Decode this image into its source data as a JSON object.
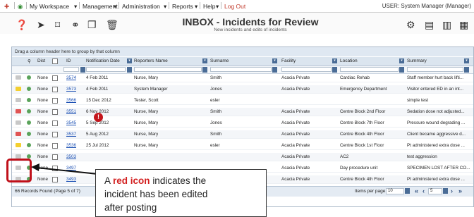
{
  "menubar": {
    "items": [
      "My Workspace",
      "Management",
      "Administration",
      "Reports",
      "Help"
    ],
    "logout": "Log Out",
    "user": "USER: System Manager (Manager)"
  },
  "page": {
    "title": "INBOX - Incidents for Review",
    "subtitle": "New incidents and edits of incidents"
  },
  "grid": {
    "group_hint": "Drag a column header here to group by that column",
    "columns": [
      "Dist",
      "ID",
      "Notification Date",
      "Reporters Name",
      "Surname",
      "Facility",
      "Location",
      "Summary"
    ],
    "rows": [
      {
        "dist": "None",
        "id": "3574",
        "date": "4 Feb 2011",
        "reporter": "Nurse, Mary",
        "surname": "Smith",
        "facility": "Acacia Private",
        "location": "Cardiac Rehab",
        "summary": "Staff member hurt back lifti..."
      },
      {
        "dist": "None",
        "id": "3573",
        "date": "4 Feb 2011",
        "reporter": "System Manager",
        "surname": "Jones",
        "facility": "Acacia Private",
        "location": "Emergency Department",
        "summary": "Visitor entered ED in an int..."
      },
      {
        "dist": "None",
        "id": "3566",
        "date": "15 Dec 2012",
        "reporter": "Tester, Scott",
        "surname": "esler",
        "facility": "",
        "location": "",
        "summary": "simple test"
      },
      {
        "dist": "None",
        "id": "3551",
        "date": "6 Nov 2012",
        "reporter": "Nurse, Mary",
        "surname": "Smith",
        "facility": "Acacia Private",
        "location": "Centre Block 2nd Floor",
        "summary": "Sedation dose not adjusted..."
      },
      {
        "dist": "None",
        "id": "3545",
        "date": "5 Sep 2012",
        "reporter": "Nurse, Mary",
        "surname": "Jones",
        "facility": "Acacia Private",
        "location": "Centre Block 7th Floor",
        "summary": "Pressure wound degrading ..."
      },
      {
        "dist": "None",
        "id": "3537",
        "date": "5 Aug 2012",
        "reporter": "Nurse, Mary",
        "surname": "Smith",
        "facility": "Acacia Private",
        "location": "Centre Block 4th Floor",
        "summary": "Client became aggressive d..."
      },
      {
        "dist": "None",
        "id": "3536",
        "date": "25 Jul 2012",
        "reporter": "Nurse, Mary",
        "surname": "esler",
        "facility": "Acacia Private",
        "location": "Centre Block 1st Floor",
        "summary": "Pt administered extra dose ..."
      },
      {
        "dist": "None",
        "id": "3503",
        "date": "",
        "reporter": "",
        "surname": "",
        "facility": "Acacia Private",
        "location": "AC2",
        "summary": "test aggression"
      },
      {
        "dist": "None",
        "id": "3497",
        "date": "",
        "reporter": "",
        "surname": "",
        "facility": "Acacia Private",
        "location": "Day procedure unit",
        "summary": "SPECIMEN LOST AFTER CO..."
      },
      {
        "dist": "None",
        "id": "3493",
        "date": "",
        "reporter": "",
        "surname": "",
        "facility": "Acacia Private",
        "location": "Centre Block 4th Floor",
        "summary": "Pt administered extra dose ..."
      }
    ],
    "records_found": "66 Records Found (Page 5 of 7)",
    "items_per_page_label": "Items per page:",
    "items_per_page": "10",
    "page_number": "5"
  },
  "callout": {
    "prefix": "A",
    "highlight": "red icon",
    "line1_rest": "indicates the",
    "line2": "incident has been edited",
    "line3": "after posting"
  },
  "colors": {
    "accent_red": "#c0101a",
    "link": "#1a4fb3",
    "header_bg": "#dbe5ef"
  }
}
